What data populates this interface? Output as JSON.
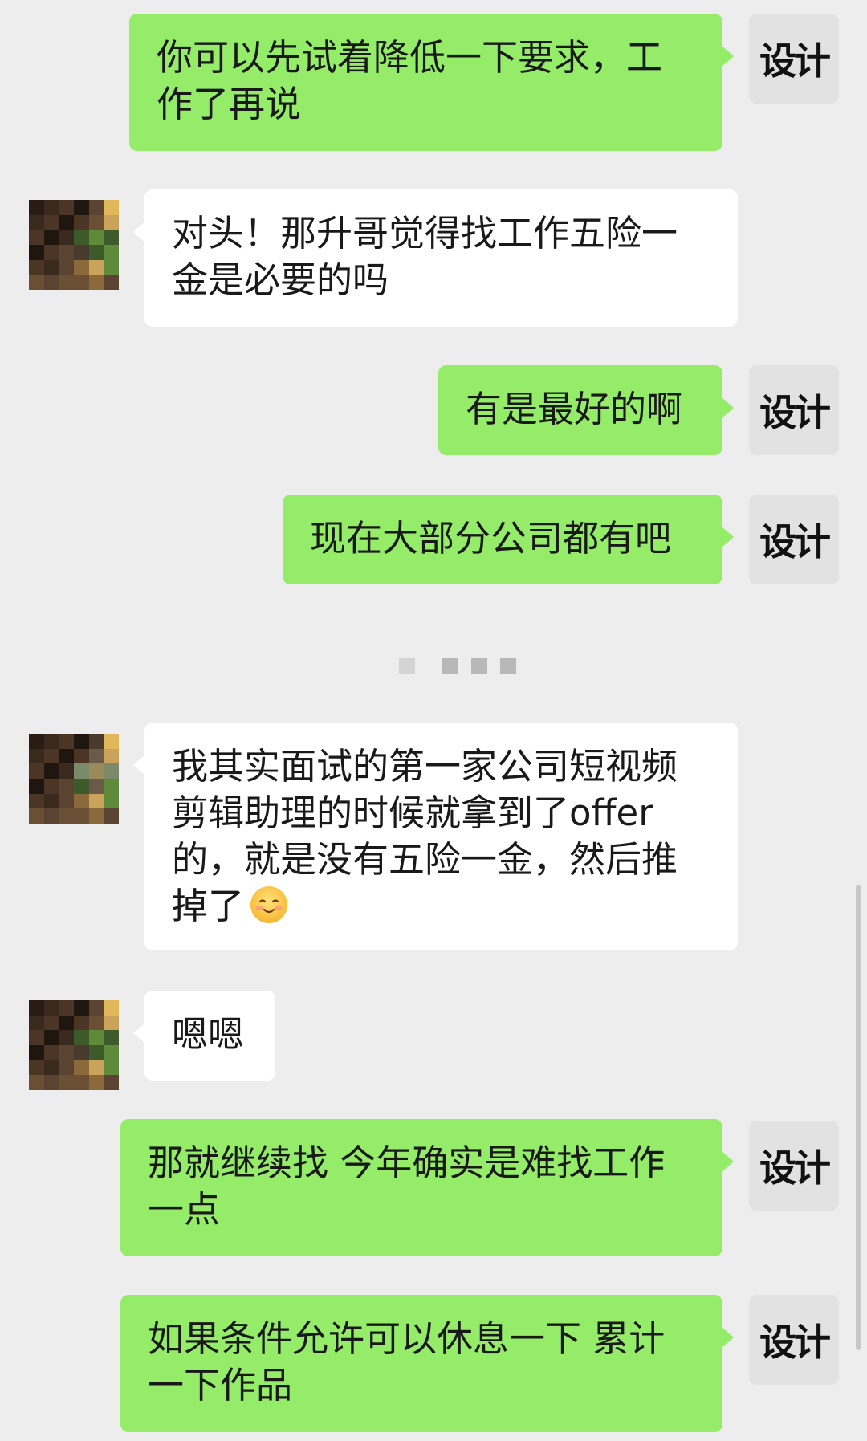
{
  "self_avatar_label": "设计",
  "messages": [
    {
      "side": "out",
      "text": "你可以先试着降低一下要求，工作了再说"
    },
    {
      "side": "in",
      "text": "对头！那升哥觉得找工作五险一金是必要的吗"
    },
    {
      "side": "out",
      "text": "有是最好的啊"
    },
    {
      "side": "out",
      "text": "现在大部分公司都有吧"
    },
    {
      "side": "in",
      "text": "我其实面试的第一家公司短视频剪辑助理的时候就拿到了offer的，就是没有五险一金，然后推掉了",
      "emoji": "smiling-face-icon"
    },
    {
      "side": "in",
      "text": "嗯嗯"
    },
    {
      "side": "out",
      "text": "那就继续找 今年确实是难找工作一点"
    },
    {
      "side": "out",
      "text": "如果条件允许可以休息一下 累计一下作品"
    }
  ],
  "colors": {
    "background": "#ededed",
    "outgoing_bubble": "#95ec69",
    "incoming_bubble": "#ffffff"
  }
}
